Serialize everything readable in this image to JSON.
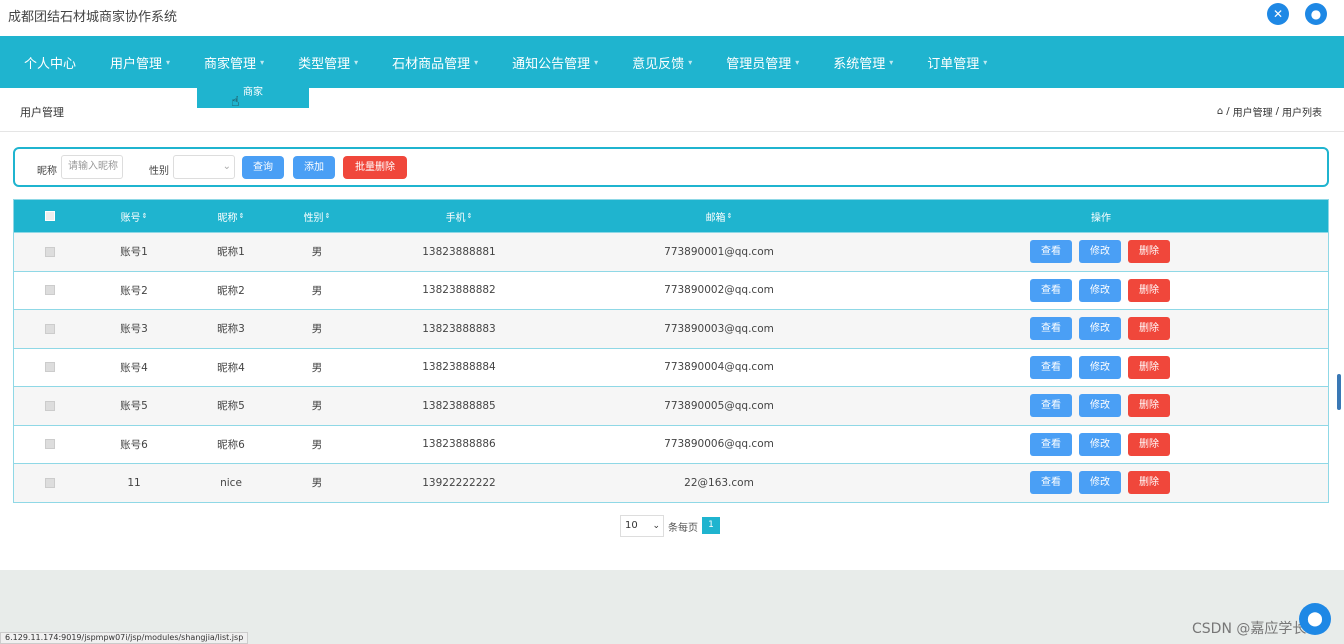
{
  "app": {
    "title": "成都团结石材城商家协作系统"
  },
  "header_icons": [
    "settings-cross-icon",
    "user-icon"
  ],
  "nav": {
    "items": [
      "个人中心",
      "用户管理",
      "商家管理",
      "类型管理",
      "石材商品管理",
      "通知公告管理",
      "意见反馈",
      "管理员管理",
      "系统管理",
      "订单管理"
    ],
    "dropdown_item": "商家"
  },
  "page": {
    "title": "用户管理",
    "breadcrumb": [
      "用户管理",
      "用户列表"
    ]
  },
  "search": {
    "nickname_label": "昵称",
    "nickname_placeholder": "请输入昵称",
    "gender_label": "性别",
    "gender_value": "",
    "query_button": "查询",
    "add_button": "添加",
    "batch_delete_button": "批量删除"
  },
  "table": {
    "columns": [
      "账号",
      "昵称",
      "性别",
      "手机",
      "邮箱",
      "操作"
    ],
    "rows": [
      {
        "account": "账号1",
        "nickname": "昵称1",
        "gender": "男",
        "phone": "13823888881",
        "email": "773890001@qq.com"
      },
      {
        "account": "账号2",
        "nickname": "昵称2",
        "gender": "男",
        "phone": "13823888882",
        "email": "773890002@qq.com"
      },
      {
        "account": "账号3",
        "nickname": "昵称3",
        "gender": "男",
        "phone": "13823888883",
        "email": "773890003@qq.com"
      },
      {
        "account": "账号4",
        "nickname": "昵称4",
        "gender": "男",
        "phone": "13823888884",
        "email": "773890004@qq.com"
      },
      {
        "account": "账号5",
        "nickname": "昵称5",
        "gender": "男",
        "phone": "13823888885",
        "email": "773890005@qq.com"
      },
      {
        "account": "账号6",
        "nickname": "昵称6",
        "gender": "男",
        "phone": "13823888886",
        "email": "773890006@qq.com"
      },
      {
        "account": "11",
        "nickname": "nice",
        "gender": "男",
        "phone": "13922222222",
        "email": "22@163.com"
      }
    ],
    "actions": {
      "view": "查看",
      "edit": "修改",
      "delete": "删除"
    }
  },
  "pagination": {
    "page_size": "10",
    "per_page_label": "条每页",
    "current_page": "1"
  },
  "status_bar_url": "6.129.11.174:9019/jspmpw07i/jsp/modules/shangjia/list.jsp",
  "watermark": "CSDN @嘉应学长",
  "colors": {
    "primary": "#1fb4cf",
    "button_blue": "#4a9ff5",
    "button_red": "#f0473b"
  }
}
